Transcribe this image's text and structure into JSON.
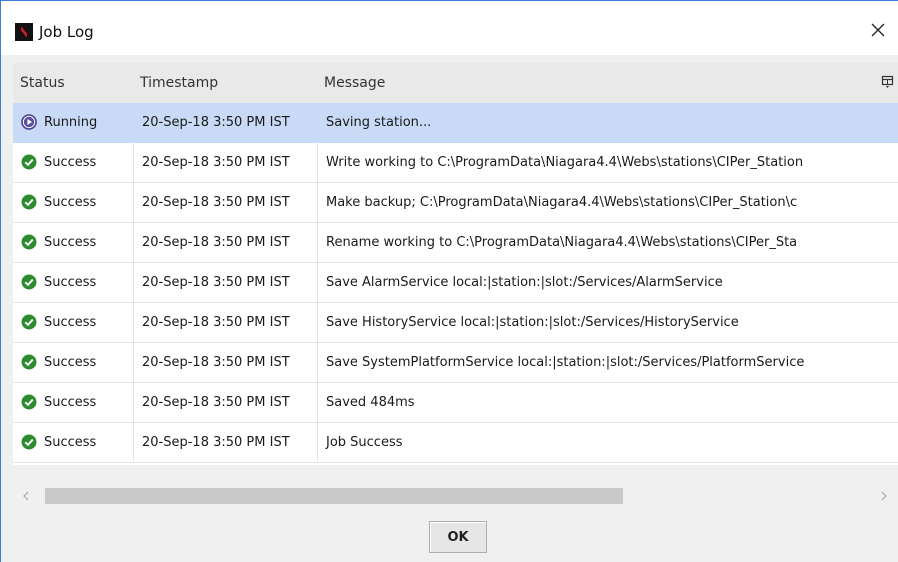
{
  "window": {
    "title": "Job Log"
  },
  "table": {
    "columns": [
      "Status",
      "Timestamp",
      "Message"
    ],
    "rows": [
      {
        "status": "Running",
        "timestamp": "20-Sep-18 3:50 PM IST",
        "message": "Saving station..."
      },
      {
        "status": "Success",
        "timestamp": "20-Sep-18 3:50 PM IST",
        "message": "Write working to C:\\ProgramData\\Niagara4.4\\Webs\\stations\\CIPer_Station"
      },
      {
        "status": "Success",
        "timestamp": "20-Sep-18 3:50 PM IST",
        "message": "Make backup; C:\\ProgramData\\Niagara4.4\\Webs\\stations\\CIPer_Station\\c"
      },
      {
        "status": "Success",
        "timestamp": "20-Sep-18 3:50 PM IST",
        "message": "Rename working to C:\\ProgramData\\Niagara4.4\\Webs\\stations\\CIPer_Sta"
      },
      {
        "status": "Success",
        "timestamp": "20-Sep-18 3:50 PM IST",
        "message": "Save AlarmService local:|station:|slot:/Services/AlarmService"
      },
      {
        "status": "Success",
        "timestamp": "20-Sep-18 3:50 PM IST",
        "message": "Save HistoryService local:|station:|slot:/Services/HistoryService"
      },
      {
        "status": "Success",
        "timestamp": "20-Sep-18 3:50 PM IST",
        "message": "Save SystemPlatformService local:|station:|slot:/Services/PlatformService"
      },
      {
        "status": "Success",
        "timestamp": "20-Sep-18 3:50 PM IST",
        "message": "Saved 484ms"
      },
      {
        "status": "Success",
        "timestamp": "20-Sep-18 3:50 PM IST",
        "message": "Job Success"
      }
    ]
  },
  "buttons": {
    "ok_label": "OK"
  },
  "icons": {
    "running": "play-circle-icon",
    "success": "check-circle-icon",
    "close": "close-icon",
    "column_chooser": "column-chooser-icon",
    "app": "niagara-logo-icon"
  },
  "colors": {
    "selection": "#c8daf5",
    "success_green": "#2e8b2e",
    "running_purple": "#4a3f8c",
    "header_bg": "#e9e9e9"
  }
}
